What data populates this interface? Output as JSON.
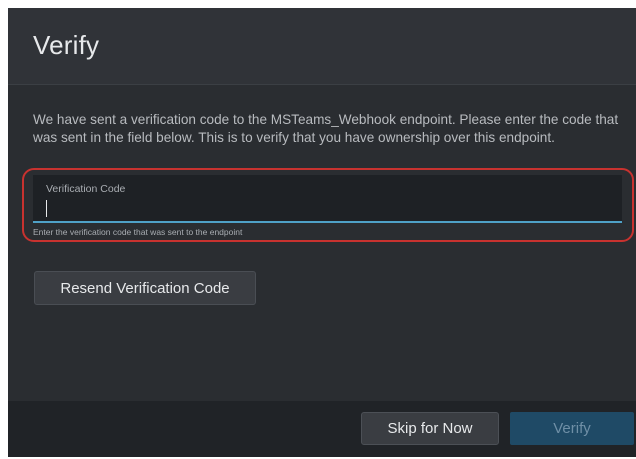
{
  "dialog": {
    "title": "Verify",
    "description": "We have sent a verification code to the MSTeams_Webhook endpoint. Please enter the code that was sent in the field below. This is to verify that you have ownership over this endpoint.",
    "verification_field": {
      "label": "Verification Code",
      "value": "",
      "helper_text": "Enter the verification code that was sent to the endpoint"
    },
    "resend_button_label": "Resend Verification Code"
  },
  "footer": {
    "skip_button_label": "Skip for Now",
    "verify_button_label": "Verify"
  },
  "colors": {
    "background": "#2a2d31",
    "focus_underline": "#4fa1c7",
    "highlight_ring": "#c8322f",
    "primary_disabled": "#1f4a66"
  }
}
